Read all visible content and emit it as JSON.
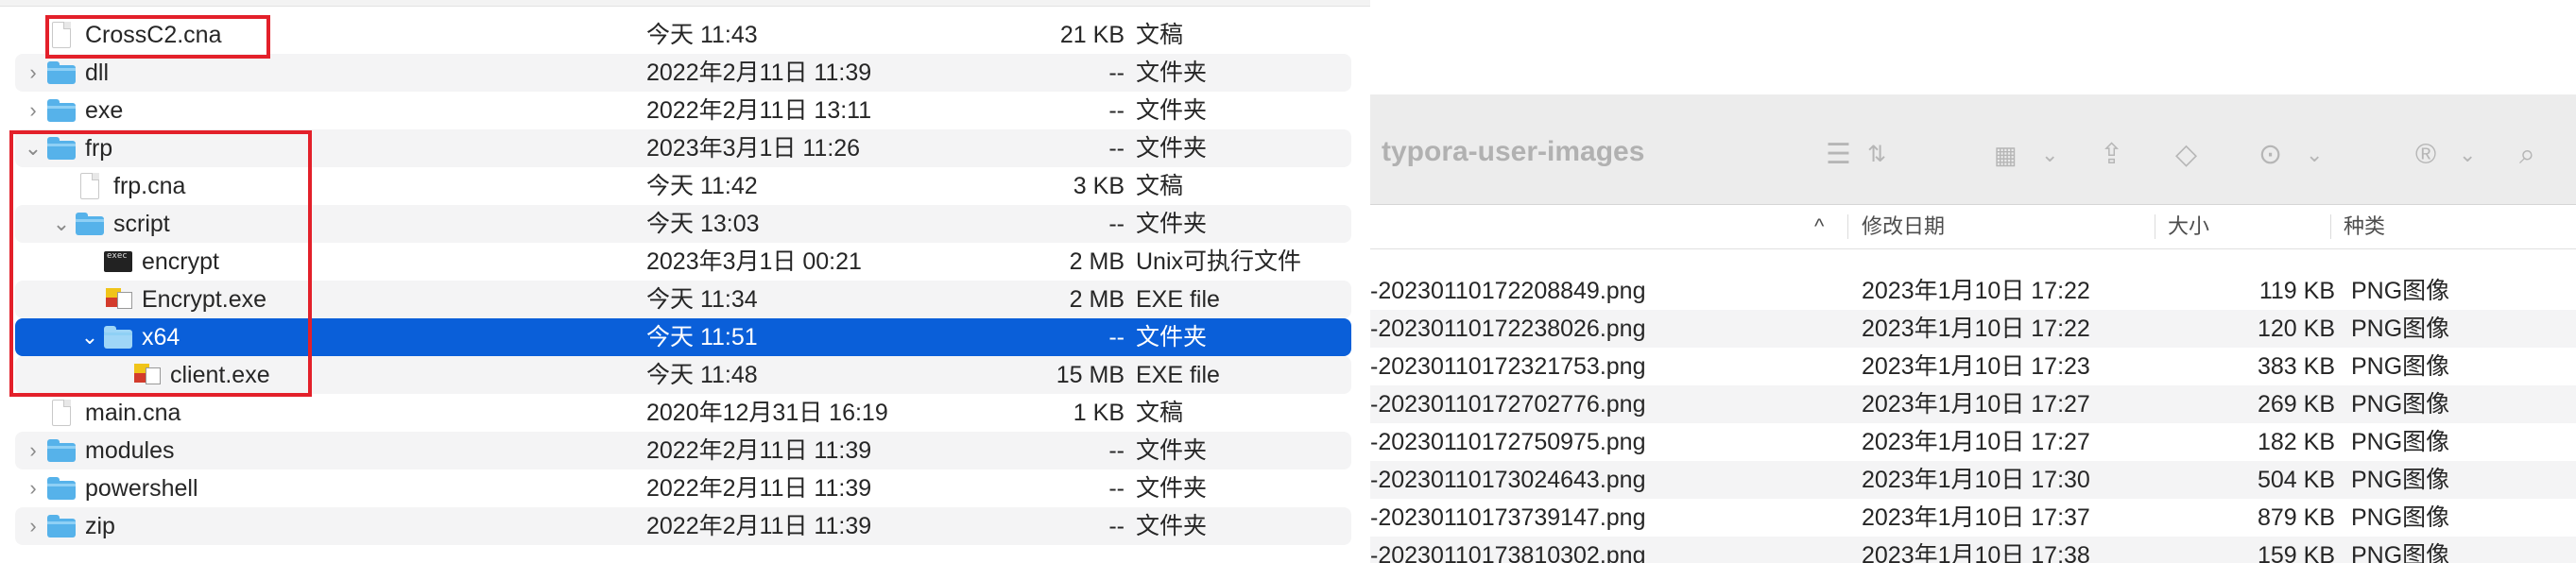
{
  "left": {
    "rows": [
      {
        "name": "CrossC2.cna",
        "date": "今天 11:43",
        "size": "21 KB",
        "kind": "文稿",
        "icon": "document-icon",
        "expanded": null
      },
      {
        "name": "dll",
        "date": "2022年2月11日 11:39",
        "size": "--",
        "kind": "文件夹",
        "icon": "folder-icon",
        "expanded": false
      },
      {
        "name": "exe",
        "date": "2022年2月11日 13:11",
        "size": "--",
        "kind": "文件夹",
        "icon": "folder-icon",
        "expanded": false
      },
      {
        "name": "frp",
        "date": "2023年3月1日 11:26",
        "size": "--",
        "kind": "文件夹",
        "icon": "folder-icon",
        "expanded": true
      },
      {
        "name": "frp.cna",
        "date": "今天 11:42",
        "size": "3 KB",
        "kind": "文稿",
        "icon": "document-icon",
        "expanded": null
      },
      {
        "name": "script",
        "date": "今天 13:03",
        "size": "--",
        "kind": "文件夹",
        "icon": "folder-icon",
        "expanded": true
      },
      {
        "name": "encrypt",
        "date": "2023年3月1日 00:21",
        "size": "2 MB",
        "kind": "Unix可执行文件",
        "icon": "terminal-icon",
        "expanded": null
      },
      {
        "name": "Encrypt.exe",
        "date": "今天 11:34",
        "size": "2 MB",
        "kind": "EXE file",
        "icon": "exe-icon",
        "expanded": null
      },
      {
        "name": "x64",
        "date": "今天 11:51",
        "size": "--",
        "kind": "文件夹",
        "icon": "folder-icon",
        "expanded": true,
        "selected": true
      },
      {
        "name": "client.exe",
        "date": "今天 11:48",
        "size": "15 MB",
        "kind": "EXE file",
        "icon": "exe-icon",
        "expanded": null
      },
      {
        "name": "main.cna",
        "date": "2020年12月31日 16:19",
        "size": "1 KB",
        "kind": "文稿",
        "icon": "document-icon",
        "expanded": null
      },
      {
        "name": "modules",
        "date": "2022年2月11日 11:39",
        "size": "--",
        "kind": "文件夹",
        "icon": "folder-icon",
        "expanded": false
      },
      {
        "name": "powershell",
        "date": "2022年2月11日 11:39",
        "size": "--",
        "kind": "文件夹",
        "icon": "folder-icon",
        "expanded": false
      },
      {
        "name": "zip",
        "date": "2022年2月11日 11:39",
        "size": "--",
        "kind": "文件夹",
        "icon": "folder-icon",
        "expanded": false
      }
    ]
  },
  "right": {
    "title": "typora-user-images",
    "toolbar_icons": [
      "list-view-icon",
      "sort-chevrons-icon",
      "grid-view-icon",
      "chevron-down-icon",
      "share-icon",
      "tag-icon",
      "more-icon",
      "chevron-down-icon",
      "registered-icon",
      "chevron-down-icon",
      "search-icon"
    ],
    "columns": {
      "sort_indicator": "^",
      "date": "修改日期",
      "size": "大小",
      "kind": "种类"
    },
    "rows": [
      {
        "name": "-20230110172208849.png",
        "date": "2023年1月10日 17:22",
        "size": "119 KB",
        "kind": "PNG图像"
      },
      {
        "name": "-20230110172238026.png",
        "date": "2023年1月10日 17:22",
        "size": "120 KB",
        "kind": "PNG图像"
      },
      {
        "name": "-20230110172321753.png",
        "date": "2023年1月10日 17:23",
        "size": "383 KB",
        "kind": "PNG图像"
      },
      {
        "name": "-20230110172702776.png",
        "date": "2023年1月10日 17:27",
        "size": "269 KB",
        "kind": "PNG图像"
      },
      {
        "name": "-20230110172750975.png",
        "date": "2023年1月10日 17:27",
        "size": "182 KB",
        "kind": "PNG图像"
      },
      {
        "name": "-20230110173024643.png",
        "date": "2023年1月10日 17:30",
        "size": "504 KB",
        "kind": "PNG图像"
      },
      {
        "name": "-20230110173739147.png",
        "date": "2023年1月10日 17:37",
        "size": "879 KB",
        "kind": "PNG图像"
      },
      {
        "name": "-20230110173810302.png",
        "date": "2023年1月10日 17:38",
        "size": "159 KB",
        "kind": "PNG图像"
      }
    ]
  },
  "colors": {
    "selection": "#0a5fd9",
    "highlight_box": "#e3202a",
    "folder": "#56b2ea"
  }
}
